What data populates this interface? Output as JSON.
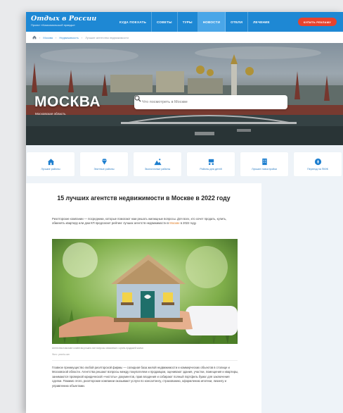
{
  "header": {
    "logo_title": "Отдых в России",
    "logo_subtitle": "Проект «Комсомольской правды»",
    "nav": [
      "КУДА ПОЕХАТЬ",
      "СОВЕТЫ",
      "ТУРЫ",
      "НОВОСТИ",
      "ОТЕЛИ",
      "ЛЕЧЕНИЕ"
    ],
    "active_nav_index": 3,
    "cta_label": "КУПИТЬ РЕКЛАМУ",
    "brand_color": "#1e88d4",
    "cta_color": "#e8432e"
  },
  "breadcrumb": [
    "Москва",
    "Недвижимость",
    "Лучшие агентства недвижимости"
  ],
  "hero": {
    "city": "МОСКВА",
    "region": "Московская область",
    "search_placeholder": "Что посмотреть в Москве"
  },
  "categories": [
    {
      "label": "Лучшие районы",
      "icon": "house-icon"
    },
    {
      "label": "Элитные районы",
      "icon": "diamond-icon"
    },
    {
      "label": "Экологичные районы",
      "icon": "mountain-icon"
    },
    {
      "label": "Районы для детей",
      "icon": "stroller-icon"
    },
    {
      "label": "Лучшие новостройки",
      "icon": "building-icon"
    },
    {
      "label": "Переезд на ПМЖ",
      "icon": "compass-icon"
    }
  ],
  "article": {
    "title": "15 лучших агентств недвижимости в Москве в 2022 году",
    "intro_before": "Риэлторские компании — посредники, которые помогают нам решать жилищные вопросы. Для всех, кто хочет продать, купить, обменять квартиру или дом КП предлагает рейтинг лучших агентств недвижимости в ",
    "intro_link": "Москве",
    "intro_after": " в 2022 году.",
    "photo_caption": "Агентства помогают клиентам решать все вопросы связанные с купли-продажей жилья",
    "photo_source": "Фото: pexels.com",
    "body": "Главное преимущество любой риэлторской фирмы — солидная база жилой недвижимости и коммерческих объектов в столице и Московской области. Агентства решают вопросы между покупателем и продавцом, оценивают здания, участки, помещения и квартиры, занимаются проверкой юридической «чистоты» документов, прав владения и собирают полный портфель бумаг для заключения сделки. Помимо этого, риэлторские компании оказывают услуги по консалтингу, страхованию, оформлению ипотеки, лизингу и управлению объектами."
  }
}
